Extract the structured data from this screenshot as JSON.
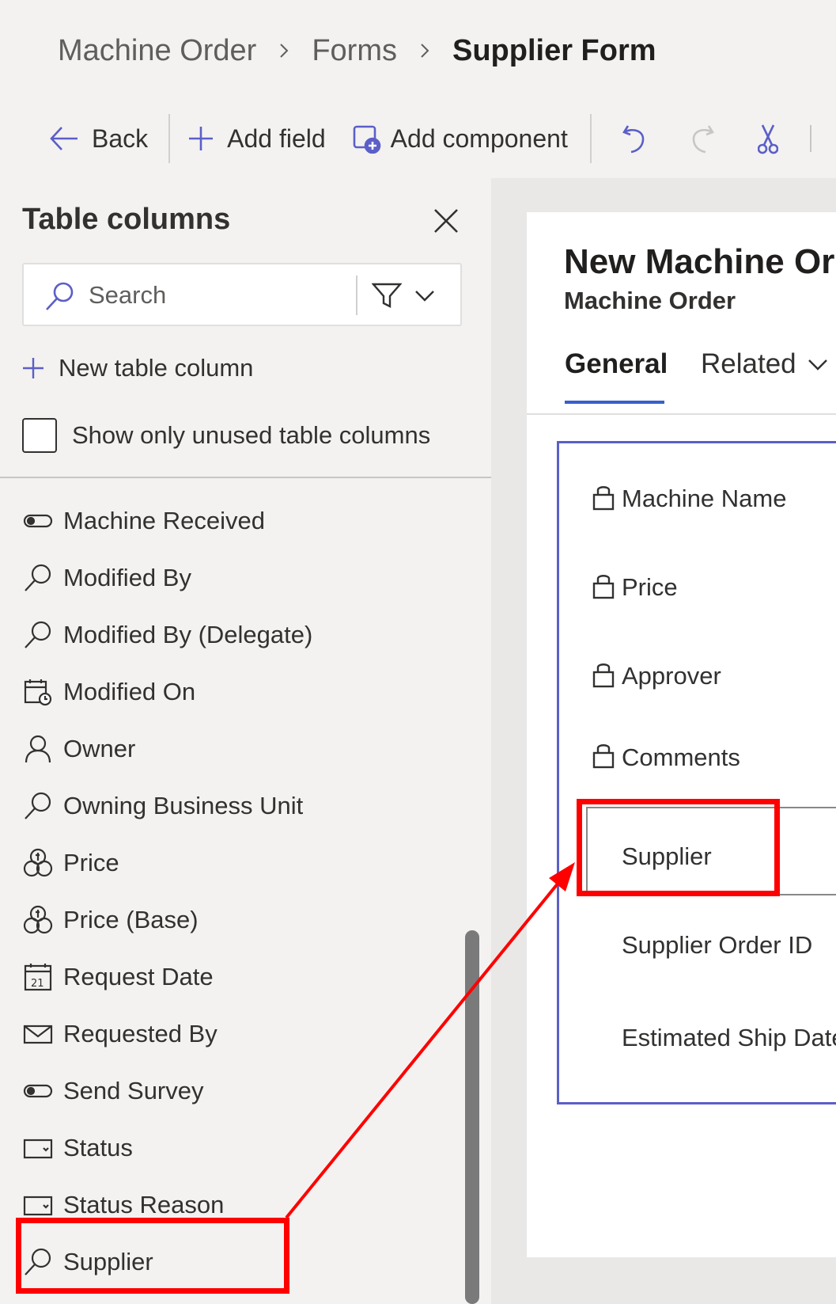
{
  "breadcrumb": {
    "items": [
      "Machine Order",
      "Forms"
    ],
    "current": "Supplier Form"
  },
  "toolbar": {
    "back_label": "Back",
    "add_field_label": "Add field",
    "add_component_label": "Add component",
    "icons": [
      "arrow-left-icon",
      "plus-icon",
      "add-component-icon",
      "undo-icon",
      "redo-icon",
      "cut-icon"
    ]
  },
  "left_pane": {
    "title": "Table columns",
    "search": {
      "placeholder": "Search",
      "value": ""
    },
    "new_column_label": "New table column",
    "unused_checkbox_label": "Show only unused table columns",
    "unused_checked": false,
    "columns": [
      {
        "label": "Machine Received",
        "icon": "toggle-icon"
      },
      {
        "label": "Modified By",
        "icon": "lookup-icon"
      },
      {
        "label": "Modified By (Delegate)",
        "icon": "lookup-icon"
      },
      {
        "label": "Modified On",
        "icon": "datetime-icon"
      },
      {
        "label": "Owner",
        "icon": "person-icon"
      },
      {
        "label": "Owning Business Unit",
        "icon": "lookup-icon"
      },
      {
        "label": "Price",
        "icon": "currency-icon"
      },
      {
        "label": "Price (Base)",
        "icon": "currency-icon"
      },
      {
        "label": "Request Date",
        "icon": "calendar-icon"
      },
      {
        "label": "Requested By",
        "icon": "email-icon"
      },
      {
        "label": "Send Survey",
        "icon": "toggle-icon"
      },
      {
        "label": "Status",
        "icon": "choice-icon"
      },
      {
        "label": "Status Reason",
        "icon": "choice-icon"
      },
      {
        "label": "Supplier",
        "icon": "lookup-icon"
      }
    ]
  },
  "form": {
    "title": "New Machine Or",
    "subtitle": "Machine Order",
    "tabs": {
      "general": "General",
      "related": "Related"
    },
    "fields": [
      {
        "label": "Machine Name",
        "locked": true
      },
      {
        "label": "Price",
        "locked": true
      },
      {
        "label": "Approver",
        "locked": true
      },
      {
        "label": "Comments",
        "locked": true
      },
      {
        "label": "Supplier",
        "locked": false,
        "selected": true
      },
      {
        "label": "Supplier Order ID",
        "locked": false
      },
      {
        "label": "Estimated Ship Date",
        "locked": false
      }
    ]
  },
  "annotation": {
    "highlight_color": "#ff0000",
    "accent": "#5b5fc7"
  }
}
